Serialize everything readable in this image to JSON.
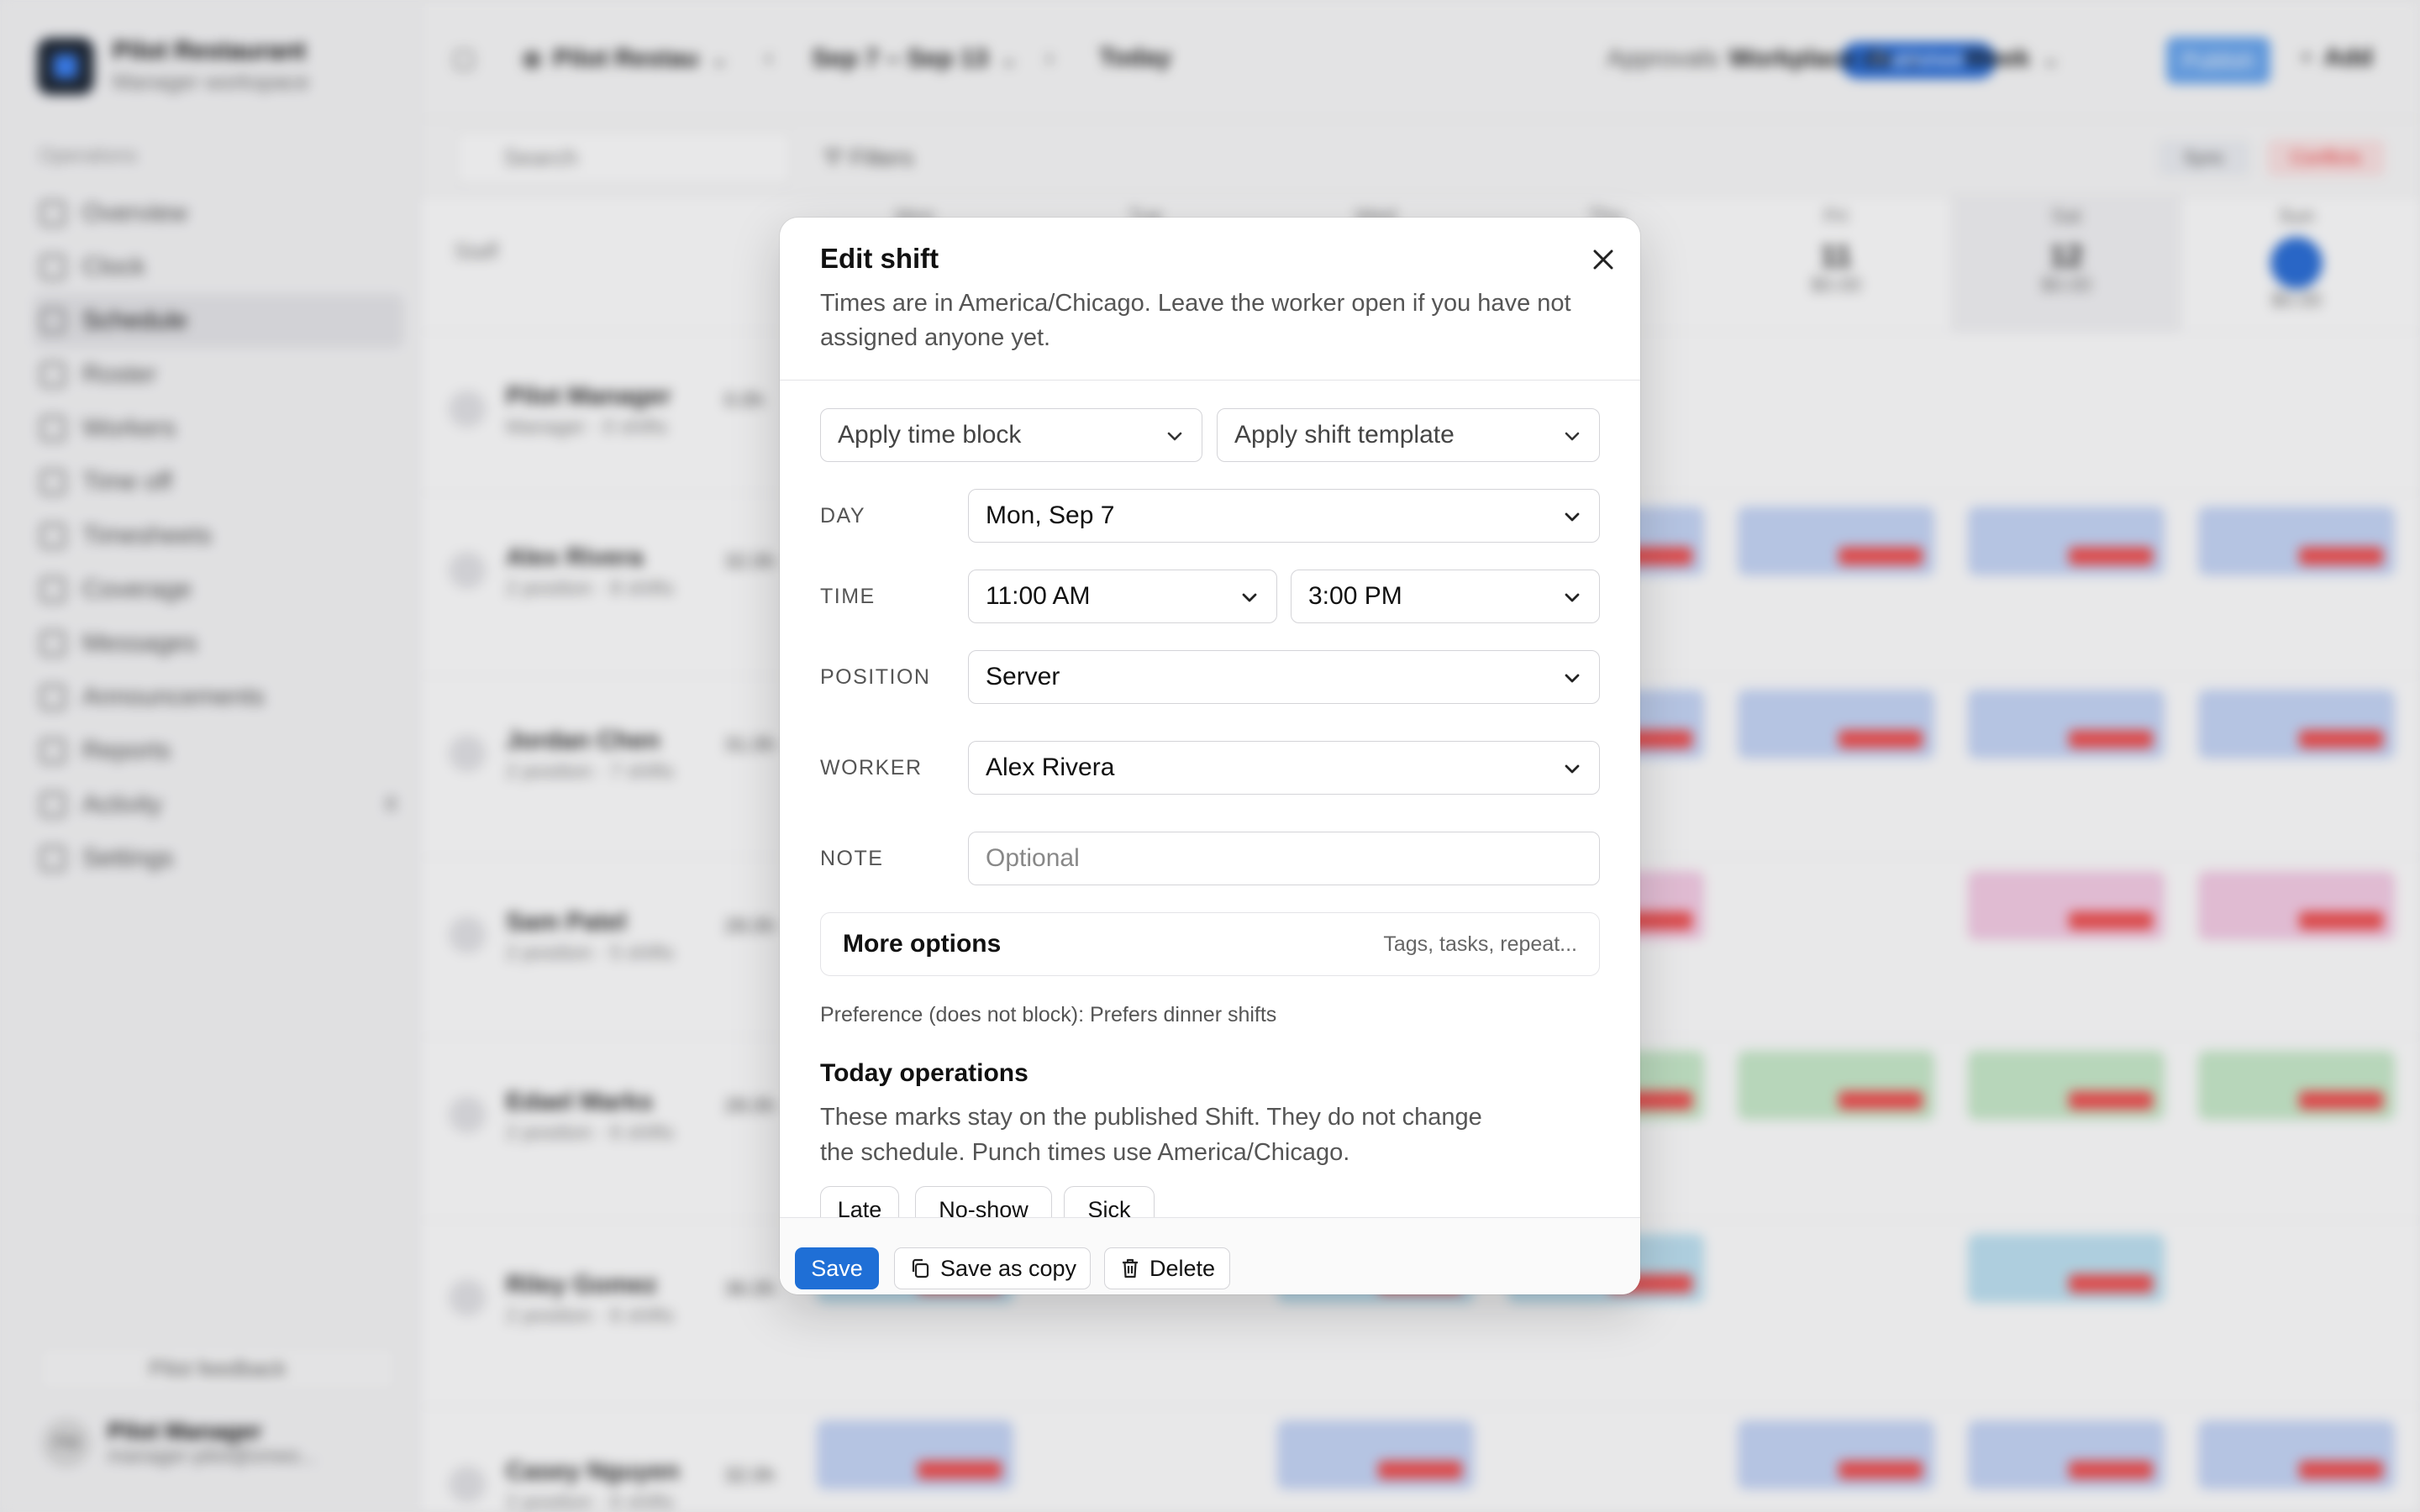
{
  "background": {
    "brand": {
      "name": "Pilot Restaurant",
      "subtitle": "Manager workspace"
    },
    "nav_section": "Operations",
    "nav_items": [
      {
        "label": "Overview",
        "icon": "grid-icon"
      },
      {
        "label": "Clock",
        "icon": "clock-icon"
      },
      {
        "label": "Schedule",
        "icon": "calendar-icon",
        "active": true
      },
      {
        "label": "Roster",
        "icon": "list-icon"
      },
      {
        "label": "Workers",
        "icon": "people-icon"
      },
      {
        "label": "Time off",
        "icon": "clock-icon"
      },
      {
        "label": "Timesheets",
        "icon": "sheet-icon"
      },
      {
        "label": "Coverage",
        "icon": "phone-icon"
      },
      {
        "label": "Messages",
        "icon": "chat-icon"
      },
      {
        "label": "Announcements",
        "icon": "megaphone-icon"
      },
      {
        "label": "Reports",
        "icon": "chart-icon"
      },
      {
        "label": "Activity",
        "icon": "activity-icon",
        "badge": "8"
      },
      {
        "label": "Settings",
        "icon": "gear-icon"
      }
    ],
    "feedback_label": "Pilot feedback",
    "user": {
      "initials": "PM",
      "name": "Pilot Manager",
      "email": "manager-pilot@onwo..."
    },
    "topbar": {
      "location": "Pilot Restau",
      "date_range": "Sep 7 – Sep 13",
      "today_label": "Today",
      "status_pill": "Published",
      "approvals_label": "Approvals",
      "workplace_label": "Workplace de",
      "view_label": "Week",
      "publish_label": "Publish",
      "add_label": "Add"
    },
    "filterbar": {
      "search_placeholder": "Search",
      "filters_label": "Filters",
      "tag1": "Sync",
      "tag2": "Conflicts"
    },
    "grid": {
      "staff_header": "Staff",
      "days": [
        {
          "dow": "Mon",
          "num": "",
          "sub": ""
        },
        {
          "dow": "Tue",
          "num": "",
          "sub": ""
        },
        {
          "dow": "Wed",
          "num": "",
          "sub": ""
        },
        {
          "dow": "Thu",
          "num": "",
          "sub": ""
        },
        {
          "dow": "Fri",
          "num": "11",
          "sub": "$0.00"
        },
        {
          "dow": "Sat",
          "num": "12",
          "sub": "$0.00"
        },
        {
          "dow": "Sun",
          "num": "13",
          "sub": "$0.00"
        }
      ],
      "rows": [
        {
          "name": "Pilot Manager",
          "sub": "Manager · 0 shifts",
          "hours": "0.0h"
        },
        {
          "name": "Alex Rivera",
          "sub": "2 position · 8 shifts",
          "hours": "32.0h"
        },
        {
          "name": "Jordan Chen",
          "sub": "2 position · 7 shifts",
          "hours": "31.0h"
        },
        {
          "name": "Sam Patel",
          "sub": "2 position · 5 shifts",
          "hours": "28.0h"
        },
        {
          "name": "Edael Marks",
          "sub": "2 position · 6 shifts",
          "hours": "28.0h"
        },
        {
          "name": "Riley Gomez",
          "sub": "2 position · 6 shifts",
          "hours": "36.0h"
        },
        {
          "name": "Casey Nguyen",
          "sub": "2 position · 6 shifts",
          "hours": "32.0h"
        }
      ]
    }
  },
  "modal": {
    "title": "Edit shift",
    "description": "Times are in America/Chicago. Leave the worker open if you have not assigned anyone yet.",
    "apply_time_block": "Apply time block",
    "apply_shift_template": "Apply shift template",
    "fields": {
      "day": {
        "label": "DAY",
        "value": "Mon, Sep 7"
      },
      "time": {
        "label": "TIME",
        "start": "11:00 AM",
        "end": "3:00 PM"
      },
      "position": {
        "label": "POSITION",
        "value": "Server"
      },
      "worker": {
        "label": "WORKER",
        "value": "Alex Rivera"
      },
      "note": {
        "label": "NOTE",
        "value": "",
        "placeholder": "Optional"
      }
    },
    "more_options": {
      "label": "More options",
      "hint": "Tags, tasks, repeat..."
    },
    "preference": "Preference (does not block): Prefers dinner shifts",
    "today_ops": {
      "title": "Today operations",
      "description": "These marks stay on the published Shift. They do not change the schedule. Punch times use America/Chicago.",
      "chips": [
        "Late",
        "No-show",
        "Sick"
      ]
    },
    "footer": {
      "save": "Save",
      "save_as_copy": "Save as copy",
      "delete": "Delete"
    }
  },
  "colors": {
    "accent": "#1f6fd6",
    "text": "#111111",
    "muted": "#555555",
    "border": "#d4d4d8"
  }
}
